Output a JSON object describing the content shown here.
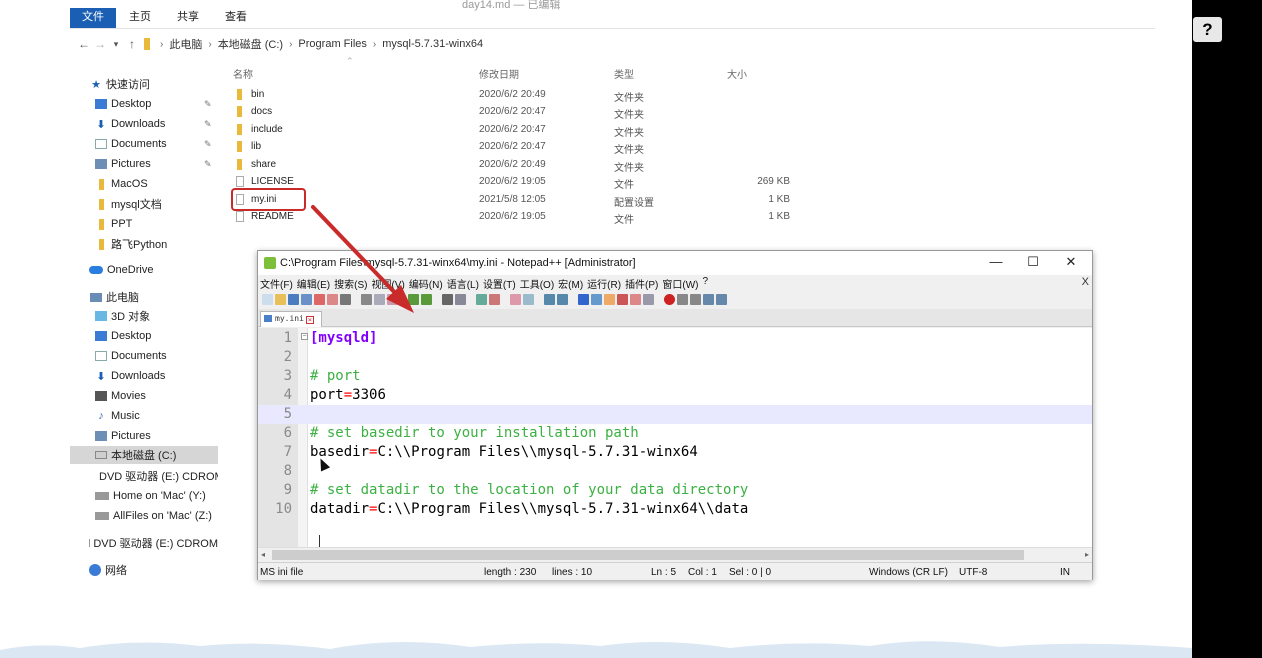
{
  "explorer": {
    "title_faint": "day14.md — 已编辑",
    "ribbon_tabs": [
      "文件",
      "主页",
      "共享",
      "查看"
    ],
    "address": [
      "此电脑",
      "本地磁盘 (C:)",
      "Program Files",
      "mysql-5.7.31-winx64"
    ],
    "columns": {
      "name": "名称",
      "date": "修改日期",
      "type": "类型",
      "size": "大小"
    },
    "nav": {
      "quick_access": "快速访问",
      "quick_items": [
        "Desktop",
        "Downloads",
        "Documents",
        "Pictures",
        "MacOS",
        "mysql文档",
        "PPT",
        "路飞Python"
      ],
      "onedrive": "OneDrive",
      "this_pc": "此电脑",
      "pc_items": [
        "3D 对象",
        "Desktop",
        "Documents",
        "Downloads",
        "Movies",
        "Music",
        "Pictures",
        "本地磁盘 (C:)",
        "DVD 驱动器 (E:) CDROM",
        "Home on 'Mac' (Y:)",
        "AllFiles on 'Mac' (Z:)"
      ],
      "dvd": "DVD 驱动器 (E:) CDROM",
      "network": "网络"
    },
    "files": [
      {
        "name": "bin",
        "date": "2020/6/2 20:49",
        "type": "文件夹",
        "size": "",
        "kind": "folder"
      },
      {
        "name": "docs",
        "date": "2020/6/2 20:47",
        "type": "文件夹",
        "size": "",
        "kind": "folder"
      },
      {
        "name": "include",
        "date": "2020/6/2 20:47",
        "type": "文件夹",
        "size": "",
        "kind": "folder"
      },
      {
        "name": "lib",
        "date": "2020/6/2 20:47",
        "type": "文件夹",
        "size": "",
        "kind": "folder"
      },
      {
        "name": "share",
        "date": "2020/6/2 20:49",
        "type": "文件夹",
        "size": "",
        "kind": "folder"
      },
      {
        "name": "LICENSE",
        "date": "2020/6/2 19:05",
        "type": "文件",
        "size": "269 KB",
        "kind": "file"
      },
      {
        "name": "my.ini",
        "date": "2021/5/8 12:05",
        "type": "配置设置",
        "size": "1 KB",
        "kind": "file"
      },
      {
        "name": "README",
        "date": "2020/6/2 19:05",
        "type": "文件",
        "size": "1 KB",
        "kind": "file"
      }
    ]
  },
  "help_label": "?",
  "notepad": {
    "title": "C:\\Program Files\\mysql-5.7.31-winx64\\my.ini - Notepad++ [Administrator]",
    "window_buttons": {
      "minimize": "—",
      "maximize": "☐",
      "close": "✕"
    },
    "menu": [
      "文件(F)",
      "编辑(E)",
      "搜索(S)",
      "视图(V)",
      "编码(N)",
      "语言(L)",
      "设置(T)",
      "工具(O)",
      "宏(M)",
      "运行(R)",
      "插件(P)",
      "窗口(W)",
      "?"
    ],
    "menu_close": "X",
    "tab": "my.ini",
    "lines": [
      {
        "n": "1",
        "parts": [
          {
            "t": "[mysqld]",
            "c": "sec"
          }
        ]
      },
      {
        "n": "2",
        "parts": []
      },
      {
        "n": "3",
        "parts": [
          {
            "t": "# port",
            "c": "com"
          }
        ]
      },
      {
        "n": "4",
        "parts": [
          {
            "t": "port",
            "c": ""
          },
          {
            "t": "=",
            "c": "eq"
          },
          {
            "t": "3306",
            "c": ""
          }
        ]
      },
      {
        "n": "5",
        "parts": []
      },
      {
        "n": "6",
        "parts": [
          {
            "t": "# set basedir to your installation path",
            "c": "com"
          }
        ]
      },
      {
        "n": "7",
        "parts": [
          {
            "t": "basedir",
            "c": ""
          },
          {
            "t": "=",
            "c": "eq"
          },
          {
            "t": "C:\\\\Program Files\\\\mysql-5.7.31-winx64",
            "c": ""
          }
        ]
      },
      {
        "n": "8",
        "parts": []
      },
      {
        "n": "9",
        "parts": [
          {
            "t": "# set datadir to the location of your data directory",
            "c": "com"
          }
        ]
      },
      {
        "n": "10",
        "parts": [
          {
            "t": "datadir",
            "c": ""
          },
          {
            "t": "=",
            "c": "eq"
          },
          {
            "t": "C:\\\\Program Files\\\\mysql-5.7.31-winx64\\\\data",
            "c": ""
          }
        ]
      }
    ],
    "current_line": 5,
    "status": {
      "filetype": "MS ini file",
      "length": "length : 230",
      "lines": "lines : 10",
      "ln": "Ln : 5",
      "col": "Col : 1",
      "sel": "Sel : 0 | 0",
      "eol": "Windows (CR LF)",
      "encoding": "UTF-8",
      "mode": "IN"
    }
  },
  "colors": {
    "accent": "#1a5fb4",
    "highlight": "#c92a2a",
    "section": "#8000ff",
    "comment": "#3cb043",
    "operator": "#ff0000"
  }
}
